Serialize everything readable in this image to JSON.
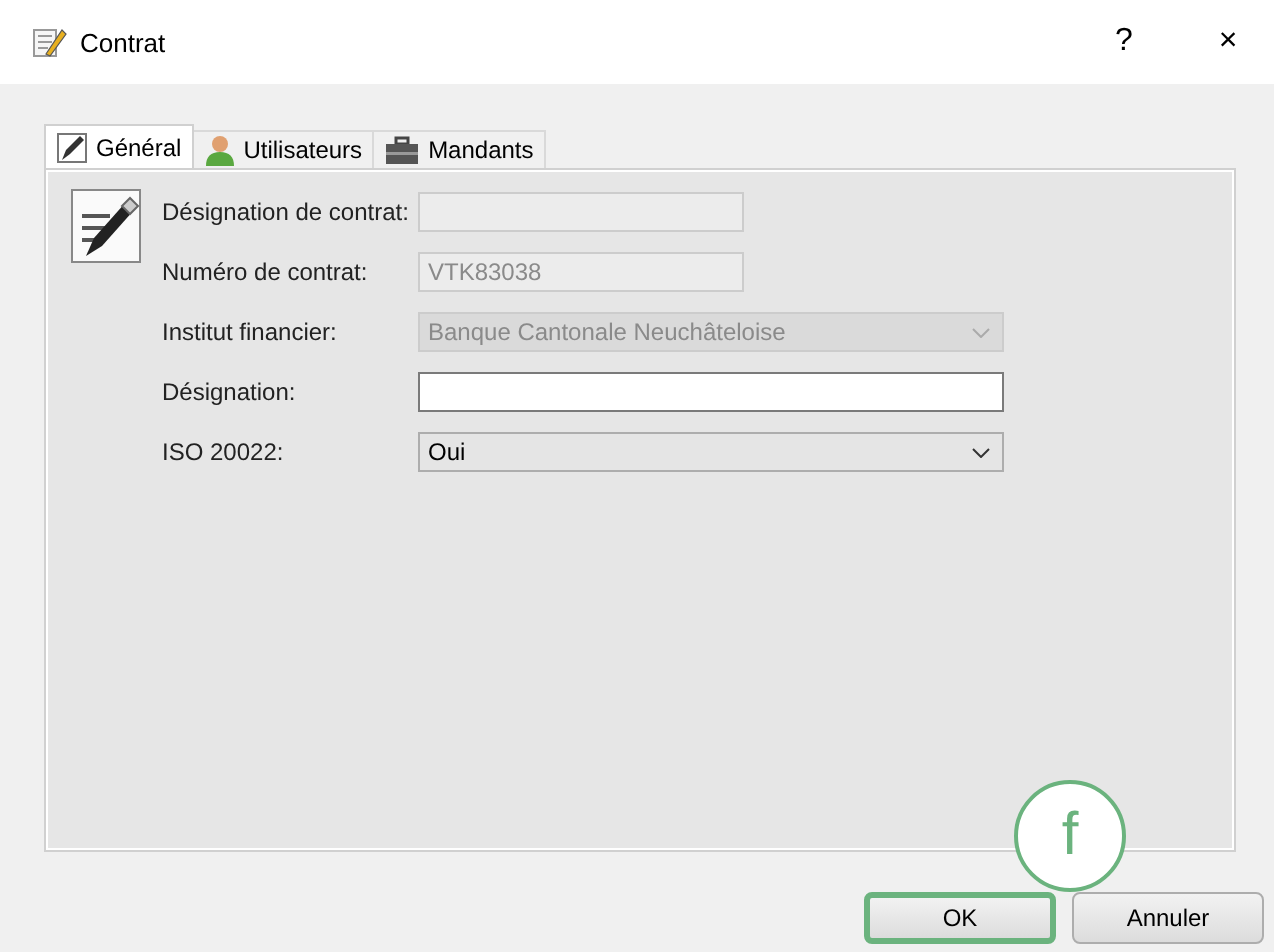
{
  "window": {
    "title": "Contrat",
    "buttons": [
      "?",
      "×"
    ]
  },
  "tabs": [
    {
      "label": "Général",
      "selected": true
    },
    {
      "label": "Utilisateurs",
      "selected": false
    },
    {
      "label": "Mandants",
      "selected": false
    }
  ],
  "fields": [
    {
      "label": "Désignation de contrat:",
      "kind": "text",
      "disabled": true
    },
    {
      "label": "Numéro de contrat:",
      "kind": "text",
      "value": "VTK83038",
      "disabled": true
    },
    {
      "label": "Institut financier:",
      "kind": "combo",
      "value": "Banque Cantonale Neuchâteloise",
      "disabled": true
    },
    {
      "label": "Désignation:",
      "kind": "text",
      "disabled": false
    },
    {
      "label": "ISO 20022:",
      "kind": "combo",
      "value": "Oui",
      "disabled": false
    }
  ],
  "buttons": [
    {
      "label": "OK",
      "highlighted": true
    },
    {
      "label": "Annuler",
      "highlighted": false
    }
  ],
  "callout": {
    "label": "f"
  }
}
